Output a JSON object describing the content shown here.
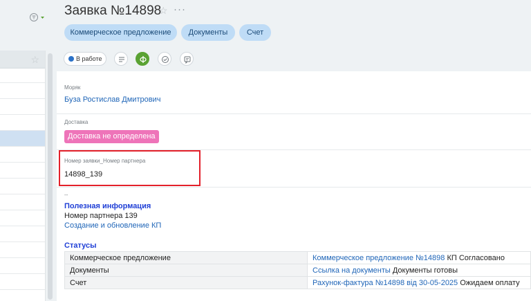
{
  "title": "Заявка №14898",
  "tabs": [
    {
      "label": "Коммерческое предложение"
    },
    {
      "label": "Документы"
    },
    {
      "label": "Счет"
    }
  ],
  "status_label": "В работе",
  "fields": {
    "sailor": {
      "label": "Моряк",
      "value": "Буза Ростислав Дмитрович"
    },
    "delivery": {
      "label": "Доставка",
      "value": "Доставка не определена"
    },
    "partner_number": {
      "label": "Номер заявки_Номер партнера",
      "value": "14898_139"
    }
  },
  "useful_info": {
    "dash": "--",
    "heading": "Полезная информация",
    "partner_line": "Номер партнера 139",
    "kp_link": "Создание и обновление КП"
  },
  "statuses": {
    "heading": "Статусы",
    "rows": [
      {
        "name": "Коммерческое предложение",
        "link": "Коммерческое предложение №14898",
        "status": " КП Согласовано"
      },
      {
        "name": "Документы",
        "link": "Ссылка на документы",
        "status": " Документы готовы"
      },
      {
        "name": "Счет",
        "link": "Рахунок-фактура №14898 від 30-05-2025",
        "status": " Ожидаем оплату"
      }
    ]
  },
  "colors": {
    "tab_bg": "#bfdcf6",
    "link": "#2066b8",
    "delivery_badge": "#ee74b9",
    "status_dot": "#2b72c8",
    "highlight_border": "#e3202a",
    "heading_blue": "#1f3fd6"
  },
  "icons": [
    "filter-icon",
    "star-icon",
    "more-icon",
    "list-icon",
    "phi-icon",
    "check-circle-icon",
    "comment-icon"
  ]
}
